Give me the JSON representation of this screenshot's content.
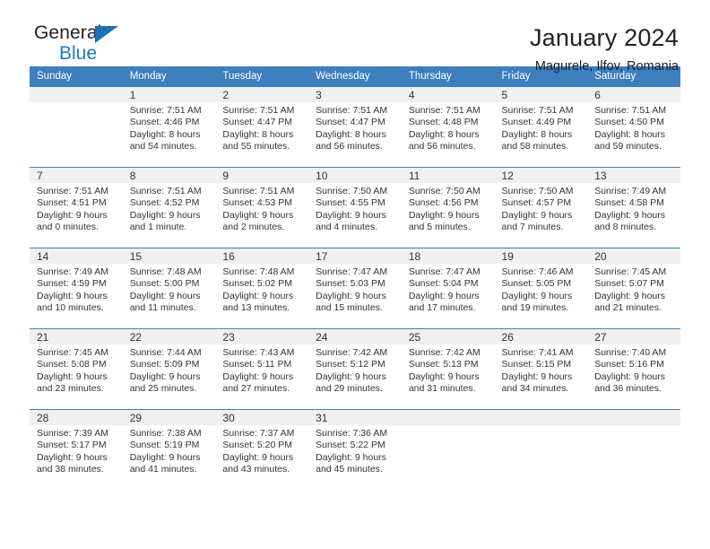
{
  "brand": {
    "name_part1": "General",
    "name_part2": "Blue",
    "accent_color": "#1d7ac4"
  },
  "header": {
    "title": "January 2024",
    "subtitle": "Magurele, Ilfov, Romania"
  },
  "calendar": {
    "header_bg": "#3d7fbf",
    "daynum_bg": "#f0f0f0",
    "weekdays": [
      "Sunday",
      "Monday",
      "Tuesday",
      "Wednesday",
      "Thursday",
      "Friday",
      "Saturday"
    ],
    "weeks": [
      [
        {
          "day": "",
          "sunrise": "",
          "sunset": "",
          "daylight": "",
          "empty": true
        },
        {
          "day": "1",
          "sunrise": "Sunrise: 7:51 AM",
          "sunset": "Sunset: 4:46 PM",
          "daylight": "Daylight: 8 hours and 54 minutes."
        },
        {
          "day": "2",
          "sunrise": "Sunrise: 7:51 AM",
          "sunset": "Sunset: 4:47 PM",
          "daylight": "Daylight: 8 hours and 55 minutes."
        },
        {
          "day": "3",
          "sunrise": "Sunrise: 7:51 AM",
          "sunset": "Sunset: 4:47 PM",
          "daylight": "Daylight: 8 hours and 56 minutes."
        },
        {
          "day": "4",
          "sunrise": "Sunrise: 7:51 AM",
          "sunset": "Sunset: 4:48 PM",
          "daylight": "Daylight: 8 hours and 56 minutes."
        },
        {
          "day": "5",
          "sunrise": "Sunrise: 7:51 AM",
          "sunset": "Sunset: 4:49 PM",
          "daylight": "Daylight: 8 hours and 58 minutes."
        },
        {
          "day": "6",
          "sunrise": "Sunrise: 7:51 AM",
          "sunset": "Sunset: 4:50 PM",
          "daylight": "Daylight: 8 hours and 59 minutes."
        }
      ],
      [
        {
          "day": "7",
          "sunrise": "Sunrise: 7:51 AM",
          "sunset": "Sunset: 4:51 PM",
          "daylight": "Daylight: 9 hours and 0 minutes."
        },
        {
          "day": "8",
          "sunrise": "Sunrise: 7:51 AM",
          "sunset": "Sunset: 4:52 PM",
          "daylight": "Daylight: 9 hours and 1 minute."
        },
        {
          "day": "9",
          "sunrise": "Sunrise: 7:51 AM",
          "sunset": "Sunset: 4:53 PM",
          "daylight": "Daylight: 9 hours and 2 minutes."
        },
        {
          "day": "10",
          "sunrise": "Sunrise: 7:50 AM",
          "sunset": "Sunset: 4:55 PM",
          "daylight": "Daylight: 9 hours and 4 minutes."
        },
        {
          "day": "11",
          "sunrise": "Sunrise: 7:50 AM",
          "sunset": "Sunset: 4:56 PM",
          "daylight": "Daylight: 9 hours and 5 minutes."
        },
        {
          "day": "12",
          "sunrise": "Sunrise: 7:50 AM",
          "sunset": "Sunset: 4:57 PM",
          "daylight": "Daylight: 9 hours and 7 minutes."
        },
        {
          "day": "13",
          "sunrise": "Sunrise: 7:49 AM",
          "sunset": "Sunset: 4:58 PM",
          "daylight": "Daylight: 9 hours and 8 minutes."
        }
      ],
      [
        {
          "day": "14",
          "sunrise": "Sunrise: 7:49 AM",
          "sunset": "Sunset: 4:59 PM",
          "daylight": "Daylight: 9 hours and 10 minutes."
        },
        {
          "day": "15",
          "sunrise": "Sunrise: 7:48 AM",
          "sunset": "Sunset: 5:00 PM",
          "daylight": "Daylight: 9 hours and 11 minutes."
        },
        {
          "day": "16",
          "sunrise": "Sunrise: 7:48 AM",
          "sunset": "Sunset: 5:02 PM",
          "daylight": "Daylight: 9 hours and 13 minutes."
        },
        {
          "day": "17",
          "sunrise": "Sunrise: 7:47 AM",
          "sunset": "Sunset: 5:03 PM",
          "daylight": "Daylight: 9 hours and 15 minutes."
        },
        {
          "day": "18",
          "sunrise": "Sunrise: 7:47 AM",
          "sunset": "Sunset: 5:04 PM",
          "daylight": "Daylight: 9 hours and 17 minutes."
        },
        {
          "day": "19",
          "sunrise": "Sunrise: 7:46 AM",
          "sunset": "Sunset: 5:05 PM",
          "daylight": "Daylight: 9 hours and 19 minutes."
        },
        {
          "day": "20",
          "sunrise": "Sunrise: 7:45 AM",
          "sunset": "Sunset: 5:07 PM",
          "daylight": "Daylight: 9 hours and 21 minutes."
        }
      ],
      [
        {
          "day": "21",
          "sunrise": "Sunrise: 7:45 AM",
          "sunset": "Sunset: 5:08 PM",
          "daylight": "Daylight: 9 hours and 23 minutes."
        },
        {
          "day": "22",
          "sunrise": "Sunrise: 7:44 AM",
          "sunset": "Sunset: 5:09 PM",
          "daylight": "Daylight: 9 hours and 25 minutes."
        },
        {
          "day": "23",
          "sunrise": "Sunrise: 7:43 AM",
          "sunset": "Sunset: 5:11 PM",
          "daylight": "Daylight: 9 hours and 27 minutes."
        },
        {
          "day": "24",
          "sunrise": "Sunrise: 7:42 AM",
          "sunset": "Sunset: 5:12 PM",
          "daylight": "Daylight: 9 hours and 29 minutes."
        },
        {
          "day": "25",
          "sunrise": "Sunrise: 7:42 AM",
          "sunset": "Sunset: 5:13 PM",
          "daylight": "Daylight: 9 hours and 31 minutes."
        },
        {
          "day": "26",
          "sunrise": "Sunrise: 7:41 AM",
          "sunset": "Sunset: 5:15 PM",
          "daylight": "Daylight: 9 hours and 34 minutes."
        },
        {
          "day": "27",
          "sunrise": "Sunrise: 7:40 AM",
          "sunset": "Sunset: 5:16 PM",
          "daylight": "Daylight: 9 hours and 36 minutes."
        }
      ],
      [
        {
          "day": "28",
          "sunrise": "Sunrise: 7:39 AM",
          "sunset": "Sunset: 5:17 PM",
          "daylight": "Daylight: 9 hours and 38 minutes."
        },
        {
          "day": "29",
          "sunrise": "Sunrise: 7:38 AM",
          "sunset": "Sunset: 5:19 PM",
          "daylight": "Daylight: 9 hours and 41 minutes."
        },
        {
          "day": "30",
          "sunrise": "Sunrise: 7:37 AM",
          "sunset": "Sunset: 5:20 PM",
          "daylight": "Daylight: 9 hours and 43 minutes."
        },
        {
          "day": "31",
          "sunrise": "Sunrise: 7:36 AM",
          "sunset": "Sunset: 5:22 PM",
          "daylight": "Daylight: 9 hours and 45 minutes."
        },
        {
          "day": "",
          "sunrise": "",
          "sunset": "",
          "daylight": "",
          "empty": true
        },
        {
          "day": "",
          "sunrise": "",
          "sunset": "",
          "daylight": "",
          "empty": true
        },
        {
          "day": "",
          "sunrise": "",
          "sunset": "",
          "daylight": "",
          "empty": true
        }
      ]
    ]
  }
}
